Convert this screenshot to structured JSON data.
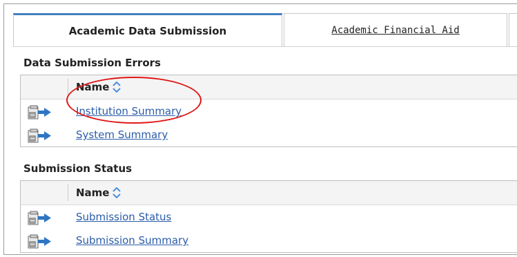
{
  "tabs": [
    {
      "label": "Academic Data Submission"
    },
    {
      "label": "Academic Financial Aid"
    }
  ],
  "sections": [
    {
      "title": "Data Submission Errors",
      "column_header": "Name",
      "rows": [
        {
          "label": "Institution Summary",
          "icon": "report-arrow-icon"
        },
        {
          "label": "System Summary",
          "icon": "report-arrow-icon"
        }
      ]
    },
    {
      "title": "Submission Status",
      "column_header": "Name",
      "rows": [
        {
          "label": "Submission Status",
          "icon": "report-arrow-icon"
        },
        {
          "label": "Submission Summary",
          "icon": "report-arrow-icon"
        }
      ]
    }
  ],
  "annotation": {
    "shape": "ellipse",
    "color": "#e01818",
    "highlights": "Institution Summary"
  },
  "colors": {
    "link": "#2a5caa",
    "tab_accent": "#3f7fbf",
    "sort_icon": "#4a90d9",
    "icon_arrow": "#2e75c4"
  }
}
